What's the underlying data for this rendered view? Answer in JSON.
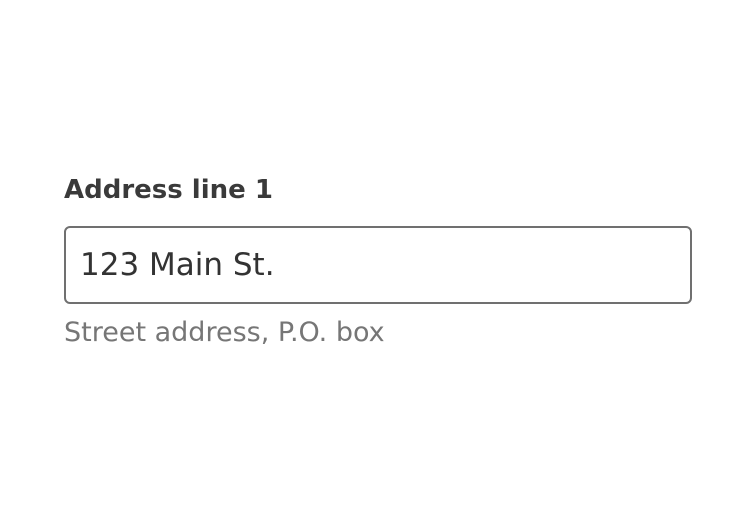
{
  "address_field": {
    "label": "Address line 1",
    "value": "123 Main St.",
    "help_text": "Street address, P.O. box"
  },
  "colors": {
    "label": "#3a3a3a",
    "input_border": "#707070",
    "input_text": "#333333",
    "help_text": "#767676",
    "background": "#ffffff"
  }
}
